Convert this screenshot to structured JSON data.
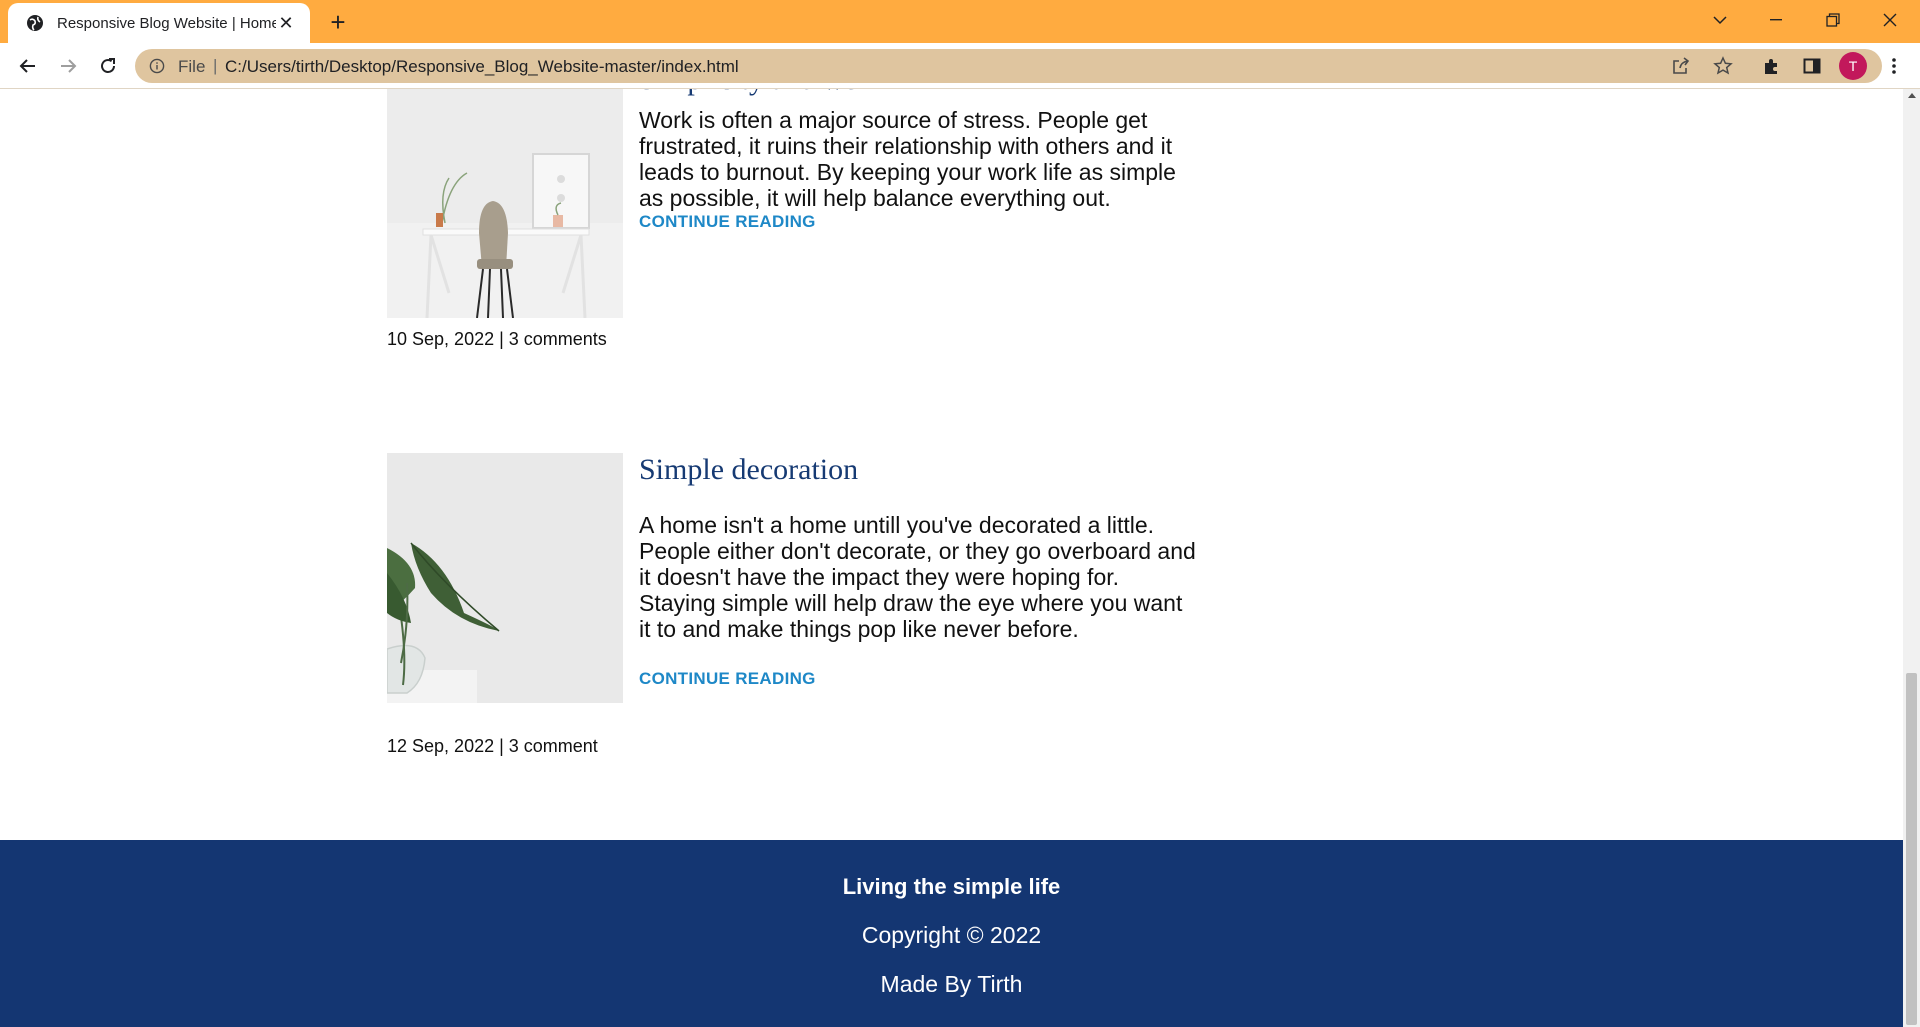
{
  "browser": {
    "tab_title": "Responsive Blog Website | Home",
    "omnibox": {
      "scheme_label": "File",
      "separator": "|",
      "url": "C:/Users/tirth/Desktop/Responsive_Blog_Website-master/index.html"
    },
    "profile_initial": "T",
    "colors": {
      "tabstrip": "#ffab40",
      "omnibox": "#dfc59f",
      "avatar": "#c2185b"
    }
  },
  "posts": [
    {
      "title": "Simplicity and work",
      "body": "Work is often a major source of stress. People get frustrated, it ruins their relationship with others and it leads to burnout. By keeping your work life as simple as possible, it will help balance everything out.",
      "link_label": "CONTINUE READING",
      "meta": "10 Sep, 2022 | 3 comments",
      "image": "desk-chair-image"
    },
    {
      "title": "Simple decoration",
      "body": "A home isn't a home untill you've decorated a little. People either don't decorate, or they go overboard and it doesn't have the impact they were hoping for. Staying simple will help draw the eye where you want it to and make things pop like never before.",
      "link_label": "CONTINUE READING",
      "meta": "12 Sep, 2022 | 3 comment",
      "image": "plant-vase-image"
    }
  ],
  "footer": {
    "tagline": "Living the simple life",
    "copyright": "Copyright © 2022",
    "made_by": "Made By Tirth",
    "background": "#143672"
  }
}
